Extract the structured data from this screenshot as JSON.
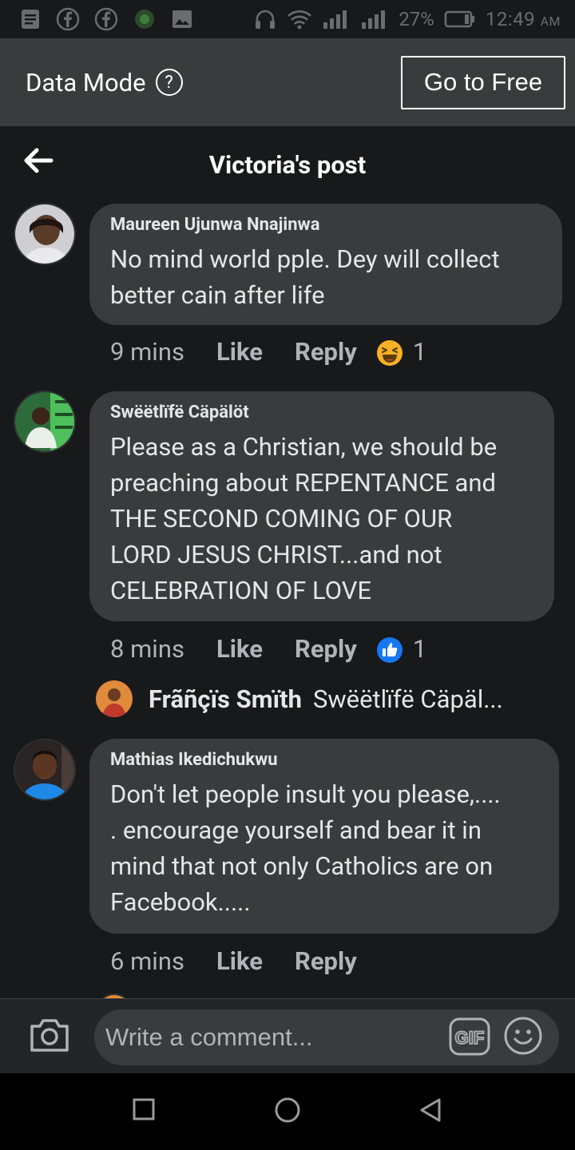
{
  "status_bar": {
    "battery": "27%",
    "time": "12:49",
    "ampm": "AM"
  },
  "data_mode": {
    "label": "Data Mode",
    "help": "?",
    "button": "Go to Free"
  },
  "header": {
    "title": "Victoria's post"
  },
  "comments": [
    {
      "author": "Maureen Ujunwa Nnajinwa",
      "text": "No mind world pple.  Dey will collect\nbetter cain after life",
      "time": "9 mins",
      "like": "Like",
      "reply": "Reply",
      "reaction": "laughing-emoji",
      "reaction_count": "1"
    },
    {
      "author": "Swëëtlïfë Cäpälöt",
      "text": "Please as a Christian, we should be\npreaching about REPENTANCE and\nTHE SECOND COMING OF OUR\nLORD JESUS CHRIST...and not\nCELEBRATION OF LOVE",
      "time": "8 mins",
      "like": "Like",
      "reply": "Reply",
      "reaction": "thumbs-up",
      "reaction_count": "1",
      "reply_preview": {
        "name": "Frãñçïs Smïth",
        "text": "Swëëtlïfë Cäpäl..."
      }
    },
    {
      "author": "Mathias Ikedichukwu",
      "text": "Don't let people insult you please,....\n. encourage yourself and bear it in\nmind that not only Catholics are on\nFacebook.....",
      "time": "6 mins",
      "like": "Like",
      "reply": "Reply"
    }
  ],
  "composer": {
    "placeholder": "Write a comment...",
    "gif": "GIF"
  },
  "colors": {
    "background": "#18191a",
    "bubble": "#3a3b3c",
    "secondary_text": "#b0b3b8",
    "like_blue": "#1877f2",
    "laugh_yellow": "#f7b125"
  }
}
